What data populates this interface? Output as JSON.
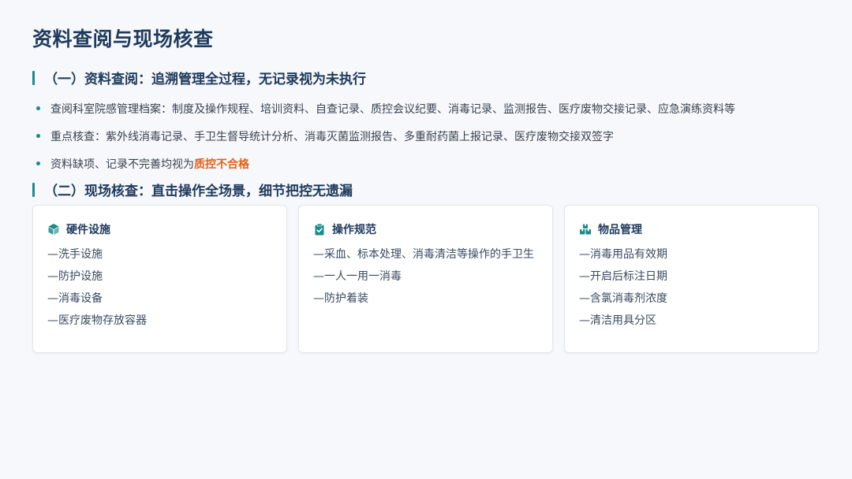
{
  "title": "资料查阅与现场核查",
  "section1": {
    "heading": "（一）资料查阅：追溯管理全过程，无记录视为未执行",
    "bullets": [
      {
        "text": "查阅科室院感管理档案：制度及操作规程、培训资料、自查记录、质控会议纪要、消毒记录、监测报告、医疗废物交接记录、应急演练资料等"
      },
      {
        "text": "重点核查：紫外线消毒记录、手卫生督导统计分析、消毒灭菌监测报告、多重耐药菌上报记录、医疗废物交接双签字"
      },
      {
        "text": "资料缺项、记录不完善均视为",
        "highlight": "质控不合格"
      }
    ]
  },
  "section2": {
    "heading": "（二）现场核查：直击操作全场景，细节把控无遗漏",
    "cards": [
      {
        "title": "硬件设施",
        "icon": "cube-icon",
        "items": [
          "—洗手设施",
          "—防护设施",
          "—消毒设备",
          "—医疗废物存放容器"
        ]
      },
      {
        "title": "操作规范",
        "icon": "clipboard-check-icon",
        "items": [
          "—采血、标本处理、消毒清洁等操作的手卫生",
          "—一人一用一消毒",
          "—防护着装"
        ]
      },
      {
        "title": "物品管理",
        "icon": "boxes-icon",
        "items": [
          "—消毒用品有效期",
          "—开启后标注日期",
          "—含氯消毒剂浓度",
          "—清洁用具分区"
        ]
      }
    ]
  },
  "colors": {
    "accent": "#1a8a8a",
    "heading": "#1f3a5c",
    "highlight": "#e0621a"
  }
}
